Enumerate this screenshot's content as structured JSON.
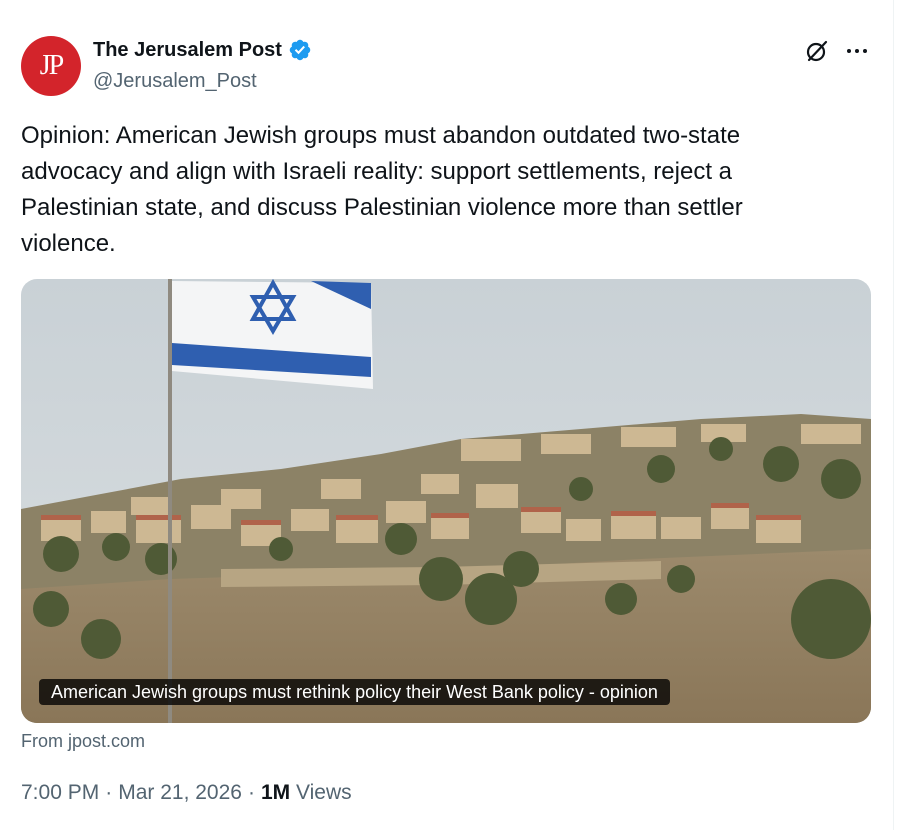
{
  "post": {
    "author": {
      "name": "The Jerusalem Post",
      "handle": "@Jerusalem_Post",
      "avatar_text": "JP",
      "verified": true
    },
    "text": "Opinion: American Jewish groups must abandon outdated two-state advocacy and align with Israeli reality: support settlements, reject a Palestinian state, and discuss Palestinian violence more than settler violence.",
    "card": {
      "caption": "American Jewish groups must rethink policy their West Bank policy - opinion",
      "source": "From jpost.com"
    },
    "meta": {
      "time": "7:00 PM",
      "separator": "·",
      "date": "Mar 21, 2026",
      "views_count": "1M",
      "views_label": "Views"
    }
  },
  "icons": {
    "verified": "verified-badge-icon",
    "grok": "grok-icon",
    "more": "more-options-icon"
  },
  "colors": {
    "verified_blue": "#1d9bf0",
    "avatar_red": "#d3242b",
    "secondary_text": "#536471",
    "primary_text": "#0f1419"
  }
}
